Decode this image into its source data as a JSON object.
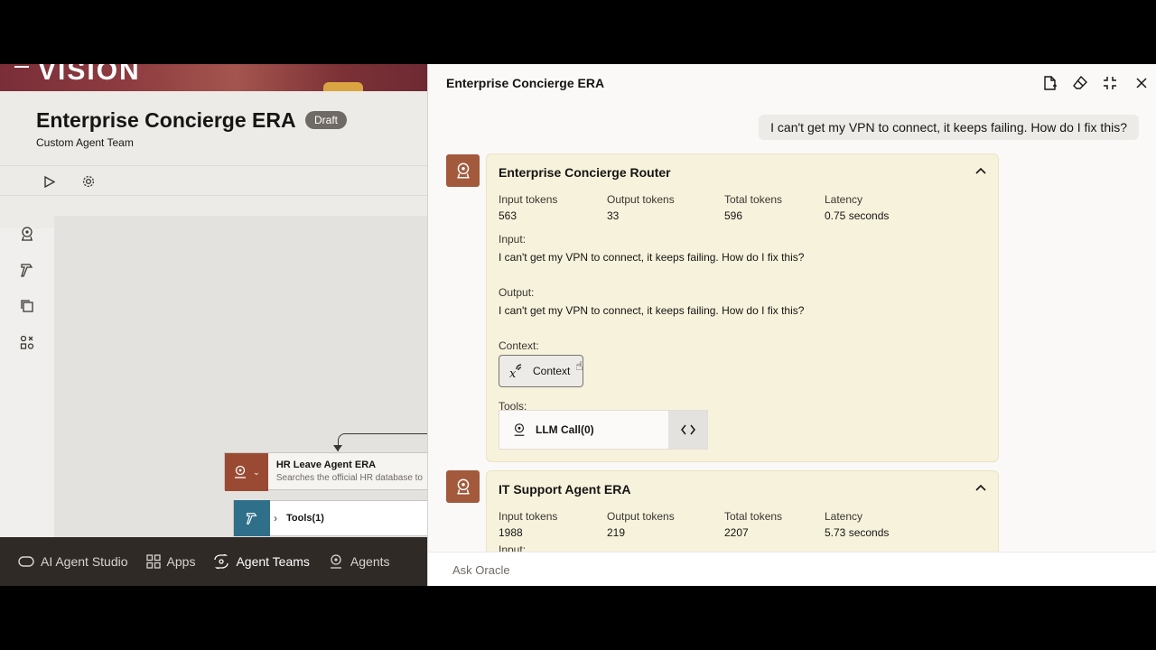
{
  "background_app": {
    "logo": "VISION",
    "title": "Enterprise Concierge ERA",
    "status_badge": "Draft",
    "subtitle": "Custom Agent Team",
    "node": {
      "title": "HR Leave Agent ERA",
      "description": "Searches the official HR database to"
    },
    "tools_node": {
      "label": "Tools(1)"
    },
    "nav": {
      "items": [
        {
          "label": "AI Agent Studio",
          "icon": "studio-icon"
        },
        {
          "label": "Apps",
          "icon": "apps-grid-icon"
        },
        {
          "label": "Agent Teams",
          "icon": "agent-teams-icon",
          "active": true
        },
        {
          "label": "Agents",
          "icon": "agent-icon"
        }
      ]
    }
  },
  "drawer": {
    "title": "Enterprise Concierge ERA",
    "header_icons": [
      "document-add-icon",
      "eraser-icon",
      "collapse-icon",
      "close-icon"
    ],
    "user_message": "I can't get my VPN to connect, it keeps failing. How do I fix this?",
    "cards": [
      {
        "title": "Enterprise Concierge Router",
        "metrics": {
          "input_tokens_label": "Input tokens",
          "input_tokens": "563",
          "output_tokens_label": "Output tokens",
          "output_tokens": "33",
          "total_tokens_label": "Total tokens",
          "total_tokens": "596",
          "latency_label": "Latency",
          "latency": "0.75 seconds"
        },
        "input_label": "Input:",
        "input_text": "I can't get my VPN to connect, it keeps failing. How do I fix this?",
        "output_label": "Output:",
        "output_text": "I can't get my VPN to connect, it keeps failing. How do I fix this?",
        "context_label": "Context:",
        "context_button": "Context",
        "tools_label": "Tools:",
        "tool_button": "LLM Call(0)"
      },
      {
        "title": "IT Support Agent ERA",
        "metrics": {
          "input_tokens_label": "Input tokens",
          "input_tokens": "1988",
          "output_tokens_label": "Output tokens",
          "output_tokens": "219",
          "total_tokens_label": "Total tokens",
          "total_tokens": "2207",
          "latency_label": "Latency",
          "latency": "5.73 seconds"
        },
        "input_label": "Input:"
      }
    ],
    "ask_placeholder": "Ask Oracle"
  },
  "colors": {
    "card_background": "#f7f2dc",
    "avatar_background": "#a3593c",
    "nav_background": "#2f2a26",
    "banner": "#8e3c40"
  }
}
